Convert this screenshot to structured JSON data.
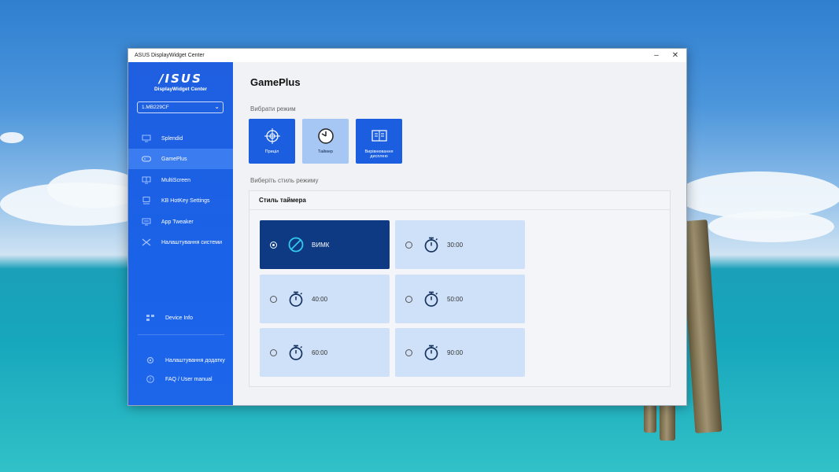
{
  "window": {
    "title": "ASUS DisplayWidget Center"
  },
  "sidebar": {
    "brand": "/ISUS",
    "subtitle": "DisplayWidget Center",
    "device": "1.MB229CF",
    "items": [
      {
        "label": "Splendid",
        "icon": "monitor-icon"
      },
      {
        "label": "GamePlus",
        "icon": "gamepad-icon",
        "active": true
      },
      {
        "label": "MultiScreen",
        "icon": "monitor-split-icon"
      },
      {
        "label": "KB HotKey Settings",
        "icon": "keyboard-monitor-icon"
      },
      {
        "label": "App Tweaker",
        "icon": "monitor-app-icon"
      },
      {
        "label": "Налаштування системи",
        "icon": "tools-icon"
      }
    ],
    "bottom": [
      {
        "label": "Device Info",
        "icon": "device-info-icon"
      },
      {
        "label": "Налаштування додатку",
        "icon": "gear-icon"
      },
      {
        "label": "FAQ / User manual",
        "icon": "help-icon"
      }
    ]
  },
  "main": {
    "title": "GamePlus",
    "mode_label": "Вибрати режим",
    "modes": [
      {
        "label": "Приціл",
        "icon": "crosshair-icon"
      },
      {
        "label": "Таймер",
        "icon": "timer-icon"
      },
      {
        "label": "Вирівнювання дисплею",
        "icon": "display-alignment-icon"
      }
    ],
    "style_label": "Виберіть стиль режиму",
    "panel_title": "Стиль таймера",
    "options": [
      {
        "label": "ВИМК",
        "icon": "off-icon",
        "selected": true
      },
      {
        "label": "30:00",
        "icon": "stopwatch-icon"
      },
      {
        "label": "40:00",
        "icon": "stopwatch-icon"
      },
      {
        "label": "50:00",
        "icon": "stopwatch-icon"
      },
      {
        "label": "60:00",
        "icon": "stopwatch-icon"
      },
      {
        "label": "90:00",
        "icon": "stopwatch-icon"
      }
    ]
  },
  "colors": {
    "sidebar": "#1f5fe0",
    "accent": "#1b5fe0",
    "selected_option": "#0d3a82",
    "option_bg": "#cfe1f8"
  }
}
